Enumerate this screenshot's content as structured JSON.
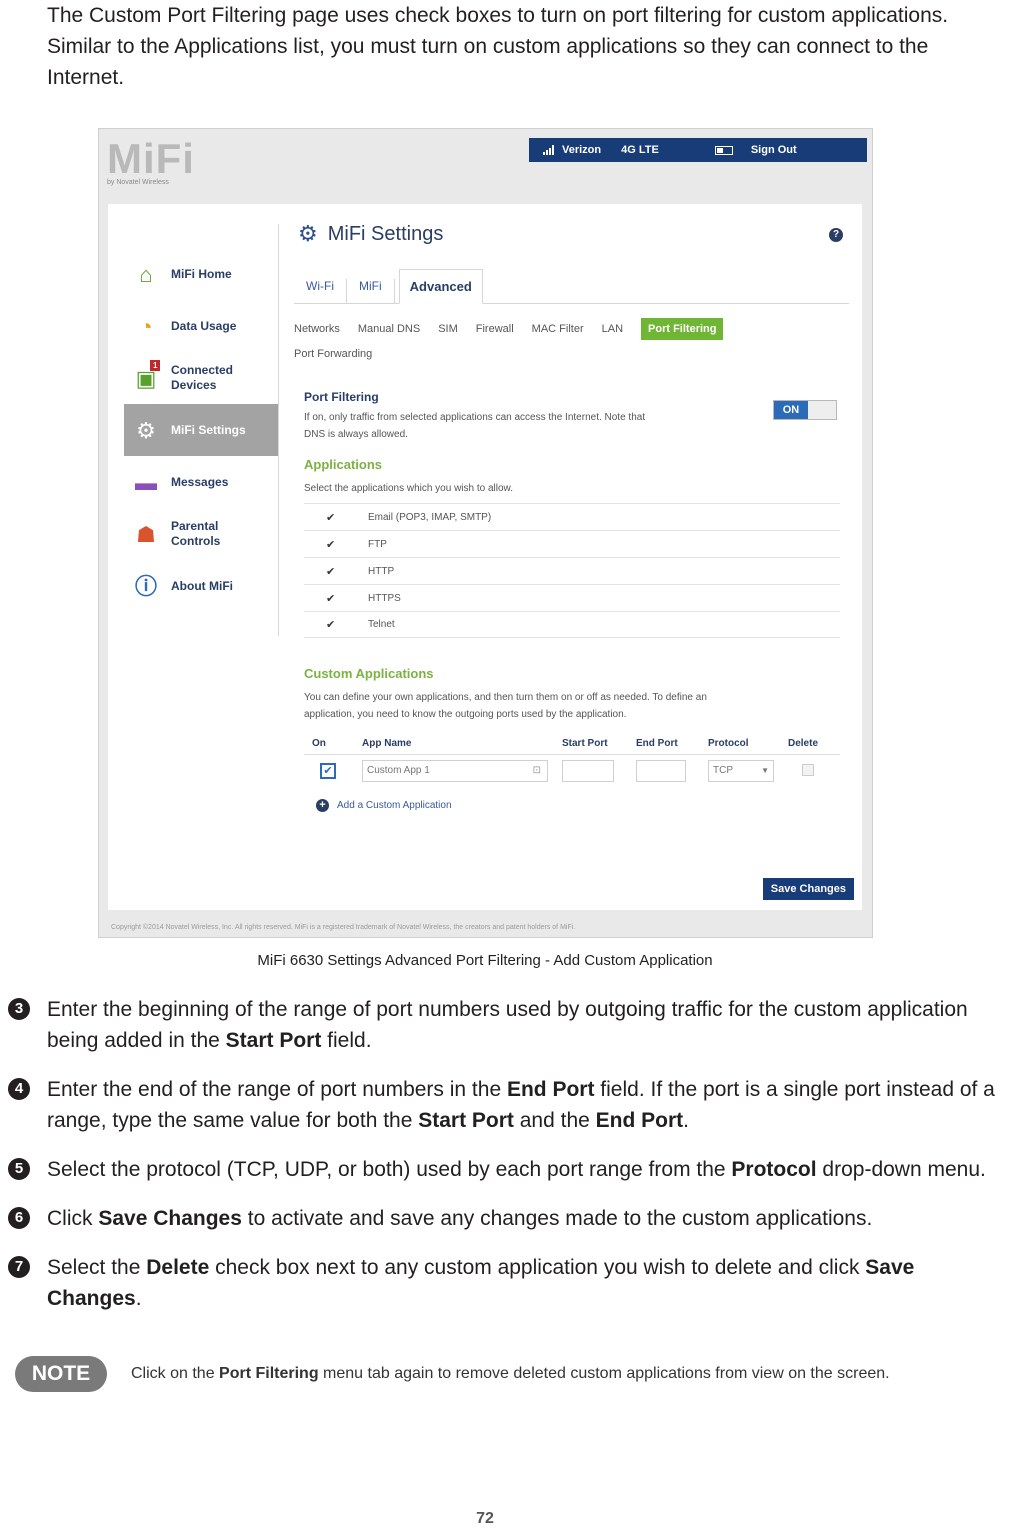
{
  "intro": "The Custom Port Filtering page uses check boxes to turn on port filtering for custom applications. Similar to the Applications list, you must turn on custom applications so they can connect to the Internet.",
  "screenshot": {
    "logo": "MiFi",
    "logo_sub": "by Novatel Wireless",
    "topbar": {
      "carrier": "Verizon",
      "network": "4G LTE",
      "sign_out": "Sign Out"
    },
    "nav": [
      {
        "label": "MiFi Home",
        "icon": "house-icon",
        "color": "#5aa02c"
      },
      {
        "label": "Data Usage",
        "icon": "gauge-icon",
        "color": "#e8a21c"
      },
      {
        "label": "Connected Devices",
        "icon": "devices-icon",
        "color": "#5aa02c",
        "badge": "1"
      },
      {
        "label": "MiFi Settings",
        "icon": "gear-icon",
        "color": "#ffffff",
        "active": true
      },
      {
        "label": "Messages",
        "icon": "message-icon",
        "color": "#8a4fb8"
      },
      {
        "label": "Parental Controls",
        "icon": "family-icon",
        "color": "#d9532c"
      },
      {
        "label": "About MiFi",
        "icon": "info-icon",
        "color": "#2b6bb8"
      }
    ],
    "page_title": "MiFi Settings",
    "help": "?",
    "tabs": [
      "Wi-Fi",
      "MiFi",
      "Advanced"
    ],
    "active_tab": "Advanced",
    "subtabs": [
      "Networks",
      "Manual DNS",
      "SIM",
      "Firewall",
      "MAC Filter",
      "LAN",
      "Port Filtering",
      "Port Forwarding"
    ],
    "active_subtab": "Port Filtering",
    "port_filtering": {
      "heading": "Port Filtering",
      "desc_1": "If on, only traffic from selected applications can access the Internet. Note that",
      "desc_2": "DNS is always allowed.",
      "toggle": "ON"
    },
    "applications": {
      "heading": "Applications",
      "desc": "Select the applications which you wish to allow.",
      "items": [
        "Email (POP3, IMAP, SMTP)",
        "FTP",
        "HTTP",
        "HTTPS",
        "Telnet"
      ],
      "checkmark": "✔"
    },
    "custom": {
      "heading": "Custom Applications",
      "desc_1": "You can define your own applications, and then turn them on or off as needed. To define an",
      "desc_2": "application, you need to know the outgoing ports used by the application.",
      "columns": {
        "on": "On",
        "app": "App Name",
        "start": "Start Port",
        "end": "End Port",
        "protocol": "Protocol",
        "delete": "Delete"
      },
      "row": {
        "app_name": "Custom App 1",
        "start_port": "",
        "end_port": "",
        "protocol": "TCP",
        "checked": "✔"
      },
      "add_label": "Add a Custom Application"
    },
    "save_button": "Save Changes",
    "copyright": "Copyright ©2014 Novatel Wireless, Inc. All rights reserved. MiFi is a registered trademark of Novatel Wireless, the creators and patent holders of MiFi."
  },
  "caption": "MiFi 6630 Settings Advanced Port Filtering - Add Custom Application",
  "steps": [
    {
      "num": "3",
      "parts": [
        [
          "Enter the beginning of the range of port numbers used by outgoing traffic for the custom application being added in the ",
          false
        ],
        [
          "Start Port",
          true
        ],
        [
          " field.",
          false
        ]
      ]
    },
    {
      "num": "4",
      "parts": [
        [
          "Enter the end of the range of port numbers in the ",
          false
        ],
        [
          "End Port",
          true
        ],
        [
          " field. If the port is a single port instead of a range, type the same value for both the ",
          false
        ],
        [
          "Start Port",
          true
        ],
        [
          " and the ",
          false
        ],
        [
          "End Port",
          true
        ],
        [
          ".",
          false
        ]
      ]
    },
    {
      "num": "5",
      "parts": [
        [
          "Select the protocol (TCP, UDP, or both) used by each port range from the ",
          false
        ],
        [
          "Protocol",
          true
        ],
        [
          " drop-down menu.",
          false
        ]
      ]
    },
    {
      "num": "6",
      "parts": [
        [
          "Click ",
          false
        ],
        [
          "Save Changes",
          true
        ],
        [
          " to activate and save any changes made to the custom applications.",
          false
        ]
      ]
    },
    {
      "num": "7",
      "parts": [
        [
          "Select the ",
          false
        ],
        [
          "Delete",
          true
        ],
        [
          " check box next to any custom application you wish to delete and click ",
          false
        ],
        [
          "Save Changes",
          true
        ],
        [
          ".",
          false
        ]
      ]
    }
  ],
  "note": {
    "badge": "NOTE",
    "pre": "Click on the ",
    "bold": "Port Filtering",
    "post": " menu tab again to remove deleted custom applications from view on the screen."
  },
  "page_number": "72"
}
